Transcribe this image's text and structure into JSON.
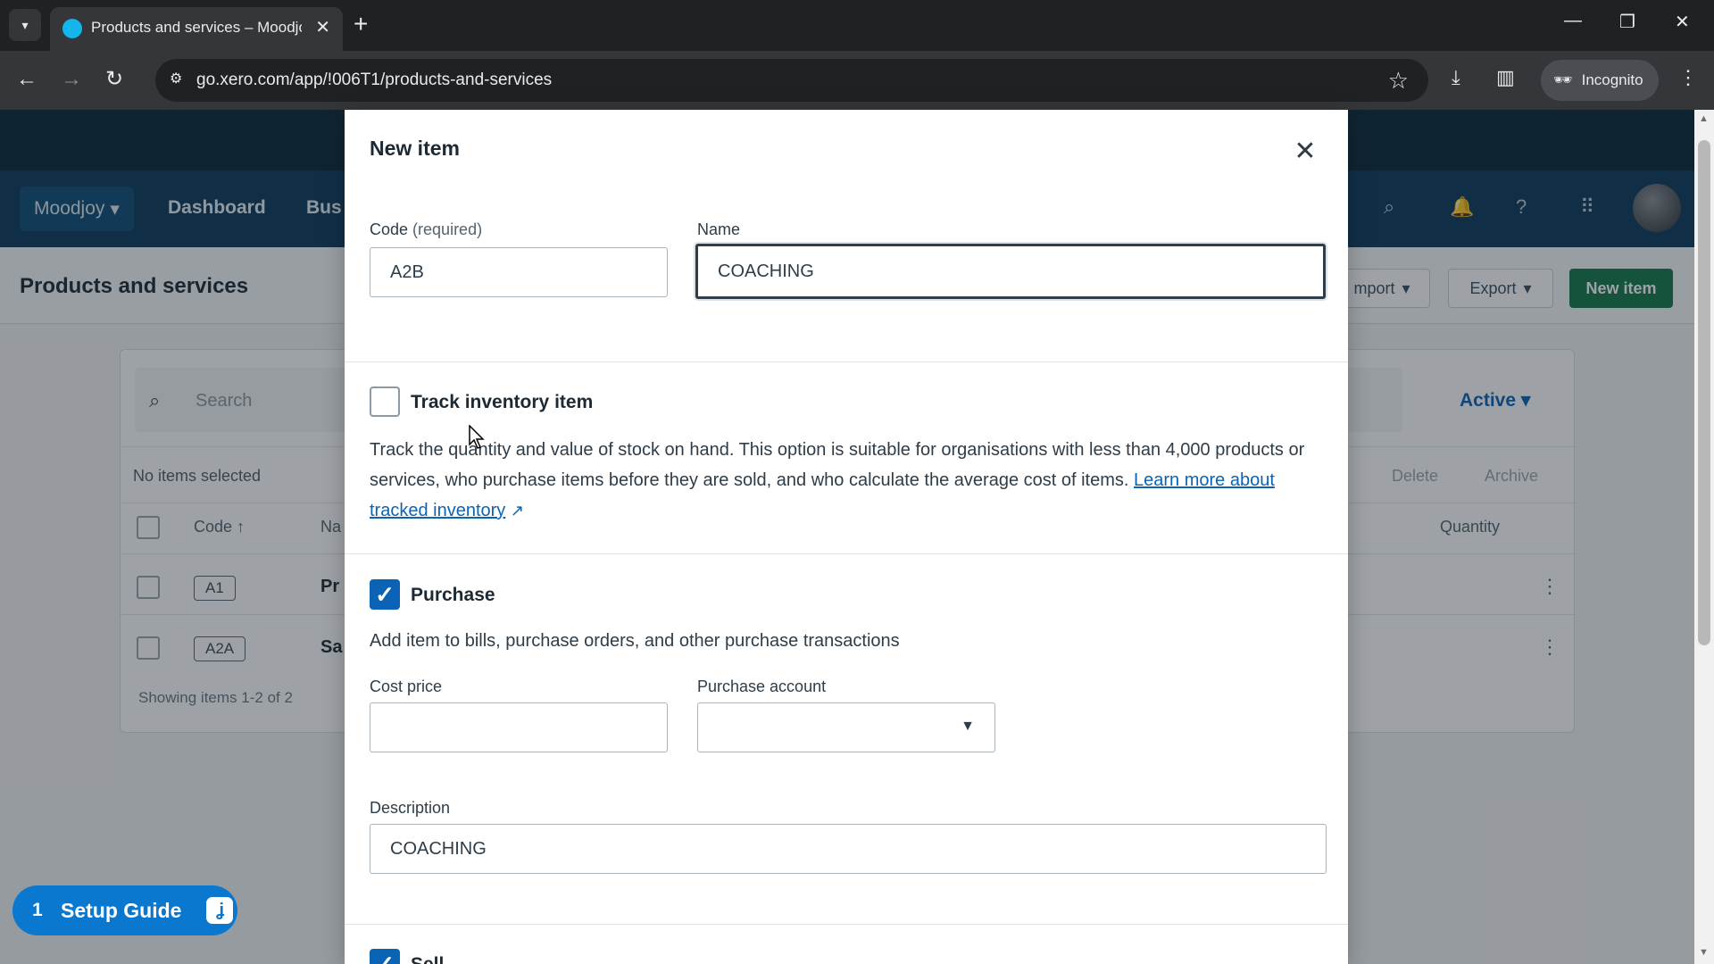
{
  "browser": {
    "tab_title": "Products and services – Moodjoy",
    "url": "go.xero.com/app/!006T1/products-and-services",
    "incognito_label": "Incognito"
  },
  "app": {
    "org_name": "Moodjoy",
    "nav": {
      "dashboard": "Dashboard",
      "business_partial": "Bus"
    },
    "page_title": "Products and services",
    "header_buttons": {
      "import_partial": "mport",
      "export": "Export",
      "new_item": "New item"
    },
    "list": {
      "search_placeholder": "Search",
      "filter": "Active",
      "selection_status": "No items selected",
      "bulk_delete": "Delete",
      "bulk_archive": "Archive",
      "columns": {
        "code": "Code",
        "name_partial": "Na",
        "quantity": "Quantity"
      },
      "rows": [
        {
          "code": "A1",
          "name_partial": "Pr"
        },
        {
          "code": "A2A",
          "name_partial": "Sa"
        }
      ],
      "showing": "Showing items 1-2 of 2"
    },
    "setup_guide": {
      "count": "1",
      "label": "Setup Guide"
    }
  },
  "modal": {
    "title": "New item",
    "code": {
      "label": "Code",
      "hint": "(required)",
      "value": "A2B"
    },
    "name": {
      "label": "Name",
      "value": "COACHING"
    },
    "track_inventory": {
      "label": "Track inventory item",
      "checked": false,
      "description": "Track the quantity and value of stock on hand. This option is suitable for organisations with less than 4,000 products or services, who purchase items before they are sold, and who calculate the average cost of items.",
      "link_text": "Learn more about tracked inventory"
    },
    "purchase": {
      "label": "Purchase",
      "checked": true,
      "description": "Add item to bills, purchase orders, and other purchase transactions",
      "cost_price_label": "Cost price",
      "cost_price_value": "",
      "account_label": "Purchase account",
      "account_value": "",
      "description_label": "Description",
      "description_value": "COACHING"
    },
    "sell": {
      "label_partial": "Sell",
      "checked": true
    }
  },
  "colors": {
    "xero_blue": "#0b63b5",
    "nav_dark": "#0b3a5c",
    "primary_green": "#13784a",
    "setup_guide_blue": "#0b78d0"
  }
}
